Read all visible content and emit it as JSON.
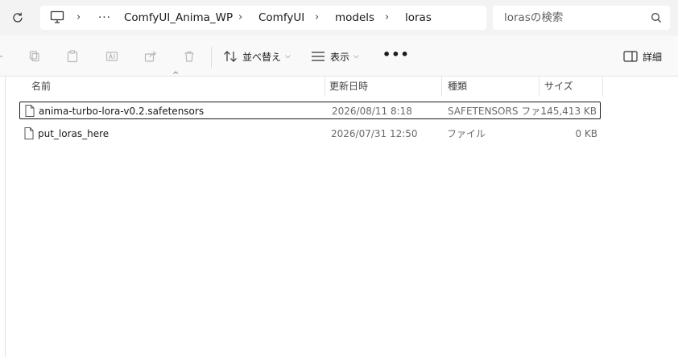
{
  "address": {
    "overflow": "···",
    "crumbs": [
      "ComfyUI_Anima_WP",
      "ComfyUI",
      "models",
      "loras"
    ],
    "separator": "›"
  },
  "search": {
    "placeholder": "lorasの検索"
  },
  "toolbar": {
    "sort_label": "並べ替え",
    "view_label": "表示",
    "more_label": "•••",
    "details_label": "詳細"
  },
  "columns": {
    "name": "名前",
    "date": "更新日時",
    "type": "種類",
    "size": "サイズ"
  },
  "files": [
    {
      "name": "anima-turbo-lora-v0.2.safetensors",
      "date": "2026/08/11 8:18",
      "type": "SAFETENSORS ファ...",
      "size": "145,413 KB",
      "selected": true
    },
    {
      "name": "put_loras_here",
      "date": "2026/07/31 12:50",
      "type": "ファイル",
      "size": "0 KB",
      "selected": false
    }
  ]
}
